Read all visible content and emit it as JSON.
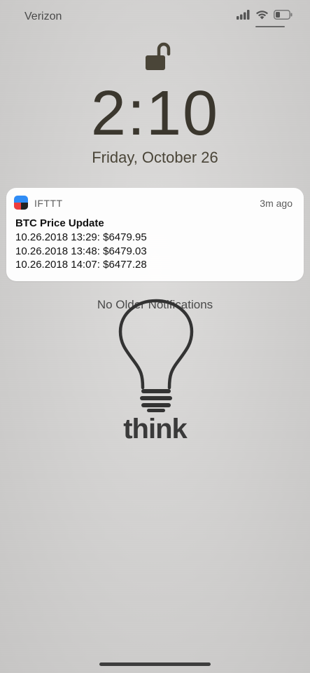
{
  "status_bar": {
    "carrier": "Verizon",
    "icons": [
      "cellular-signal-icon",
      "wifi-icon",
      "battery-icon"
    ],
    "battery_level": 0.25
  },
  "lock_screen": {
    "lock_icon": "unlocked-padlock-icon",
    "time": "2:10",
    "date": "Friday, October 26"
  },
  "notification": {
    "app_name": "IFTTT",
    "age": "3m ago",
    "title": "BTC Price Update",
    "lines": [
      "10.26.2018 13:29: $6479.95",
      "10.26.2018 13:48: $6479.03",
      "10.26.2018 14:07: $6477.28"
    ]
  },
  "footer_text": "No Older Notifications",
  "wallpaper": {
    "icon": "lightbulb-icon",
    "caption": "think"
  },
  "colors": {
    "time_color": "#3b372e",
    "app_icon_blue": "#2f8cf5",
    "app_icon_red": "#ee3d3d"
  }
}
